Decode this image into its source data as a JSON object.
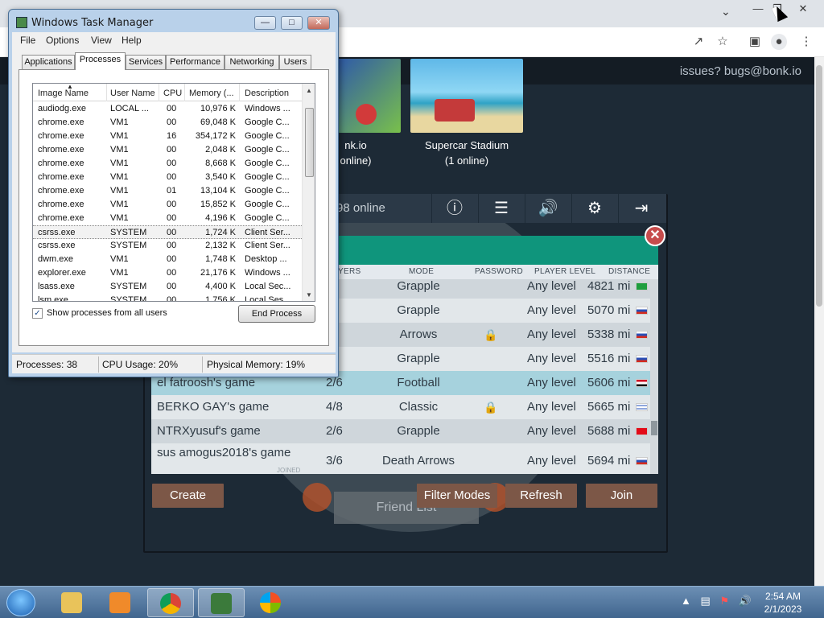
{
  "browser": {
    "minimize_icon": "minimize-icon",
    "restore_icon": "restore-icon",
    "close_icon": "close-icon",
    "tab_search_icon": "chevron-down-icon",
    "toolbar_icons": [
      "share-icon",
      "star-icon",
      "sidepanel-icon",
      "profile-icon",
      "kebab-menu-icon"
    ]
  },
  "game": {
    "issues_text": "issues? bugs@bonk.io",
    "thumbnails": [
      {
        "line1": "nk.io",
        "line2": "online)"
      },
      {
        "line1": "Supercar Stadium",
        "line2": "(1 online)"
      }
    ],
    "online_text": "98 online",
    "menu_icons": [
      "help-icon",
      "spectate-icon",
      "volume-icon",
      "settings-icon",
      "exit-icon"
    ],
    "close_label": "✕",
    "columns": {
      "players": "YERS",
      "mode": "MODE",
      "password": "PASSWORD",
      "level": "PLAYER LEVEL",
      "distance": "DISTANCE"
    },
    "rooms": [
      {
        "name": "",
        "players": "/6",
        "mode": "Grapple",
        "locked": false,
        "level": "Any level",
        "distance": "4821 mi",
        "flag": "brazil",
        "highlight": false
      },
      {
        "name": "",
        "players": "/6",
        "mode": "Grapple",
        "locked": false,
        "level": "Any level",
        "distance": "5070 mi",
        "flag": "russia",
        "highlight": false
      },
      {
        "name": "",
        "players": "/6",
        "mode": "Arrows",
        "locked": true,
        "level": "Any level",
        "distance": "5338 mi",
        "flag": "russia",
        "highlight": false
      },
      {
        "name": "",
        "players": "/6",
        "mode": "Grapple",
        "locked": false,
        "level": "Any level",
        "distance": "5516 mi",
        "flag": "russia",
        "highlight": false
      },
      {
        "name": "el fatroosh's game",
        "players": "2/6",
        "mode": "Football",
        "locked": false,
        "level": "Any level",
        "distance": "5606 mi",
        "flag": "egypt",
        "highlight": true
      },
      {
        "name": "BERKO GAY's game",
        "players": "4/8",
        "mode": "Classic",
        "locked": true,
        "level": "Any level",
        "distance": "5665 mi",
        "flag": "israel",
        "highlight": false
      },
      {
        "name": "NTRXyusuf's game",
        "players": "2/6",
        "mode": "Grapple",
        "locked": false,
        "level": "Any level",
        "distance": "5688 mi",
        "flag": "turkey",
        "highlight": false
      },
      {
        "name": "sus amogus2018's game",
        "players": "3/6",
        "mode": "Death Arrows",
        "locked": false,
        "level": "Any level",
        "distance": "5694 mi",
        "flag": "russia",
        "highlight": false
      }
    ],
    "joined_tag": "JOINED",
    "buttons": {
      "create": "Create",
      "filter": "Filter Modes",
      "refresh": "Refresh",
      "join": "Join"
    },
    "friend_list": "Friend List"
  },
  "taskmanager": {
    "title": "Windows Task Manager",
    "menu": [
      "File",
      "Options",
      "View",
      "Help"
    ],
    "tabs": [
      "Applications",
      "Processes",
      "Services",
      "Performance",
      "Networking",
      "Users"
    ],
    "active_tab": "Processes",
    "headers": [
      "Image Name",
      "User Name",
      "CPU",
      "Memory (...",
      "Description"
    ],
    "processes": [
      {
        "name": "audiodg.exe",
        "user": "LOCAL ...",
        "cpu": "00",
        "mem": "10,976 K",
        "desc": "Windows ..."
      },
      {
        "name": "chrome.exe",
        "user": "VM1",
        "cpu": "00",
        "mem": "69,048 K",
        "desc": "Google C..."
      },
      {
        "name": "chrome.exe",
        "user": "VM1",
        "cpu": "16",
        "mem": "354,172 K",
        "desc": "Google C..."
      },
      {
        "name": "chrome.exe",
        "user": "VM1",
        "cpu": "00",
        "mem": "2,048 K",
        "desc": "Google C..."
      },
      {
        "name": "chrome.exe",
        "user": "VM1",
        "cpu": "00",
        "mem": "8,668 K",
        "desc": "Google C..."
      },
      {
        "name": "chrome.exe",
        "user": "VM1",
        "cpu": "00",
        "mem": "3,540 K",
        "desc": "Google C..."
      },
      {
        "name": "chrome.exe",
        "user": "VM1",
        "cpu": "01",
        "mem": "13,104 K",
        "desc": "Google C..."
      },
      {
        "name": "chrome.exe",
        "user": "VM1",
        "cpu": "00",
        "mem": "15,852 K",
        "desc": "Google C..."
      },
      {
        "name": "chrome.exe",
        "user": "VM1",
        "cpu": "00",
        "mem": "4,196 K",
        "desc": "Google C..."
      },
      {
        "name": "csrss.exe",
        "user": "SYSTEM",
        "cpu": "00",
        "mem": "1,724 K",
        "desc": "Client Ser...",
        "highlight": true
      },
      {
        "name": "csrss.exe",
        "user": "SYSTEM",
        "cpu": "00",
        "mem": "2,132 K",
        "desc": "Client Ser..."
      },
      {
        "name": "dwm.exe",
        "user": "VM1",
        "cpu": "00",
        "mem": "1,748 K",
        "desc": "Desktop ..."
      },
      {
        "name": "explorer.exe",
        "user": "VM1",
        "cpu": "00",
        "mem": "21,176 K",
        "desc": "Windows ..."
      },
      {
        "name": "lsass.exe",
        "user": "SYSTEM",
        "cpu": "00",
        "mem": "4,400 K",
        "desc": "Local Sec..."
      },
      {
        "name": "lsm.exe",
        "user": "SYSTEM",
        "cpu": "00",
        "mem": "1,756 K",
        "desc": "Local Ses..."
      }
    ],
    "show_all_label": "Show processes from all users",
    "show_all_checked": true,
    "end_process": "End Process",
    "status": {
      "processes": "Processes: 38",
      "cpu": "CPU Usage: 20%",
      "memory": "Physical Memory: 19%"
    }
  },
  "taskbar": {
    "apps": [
      "explorer-icon",
      "media-player-icon",
      "chrome-icon",
      "task-manager-icon",
      "windows-update-icon"
    ],
    "active_app": "chrome-icon",
    "time": "2:54 AM",
    "date": "2/1/2023"
  }
}
